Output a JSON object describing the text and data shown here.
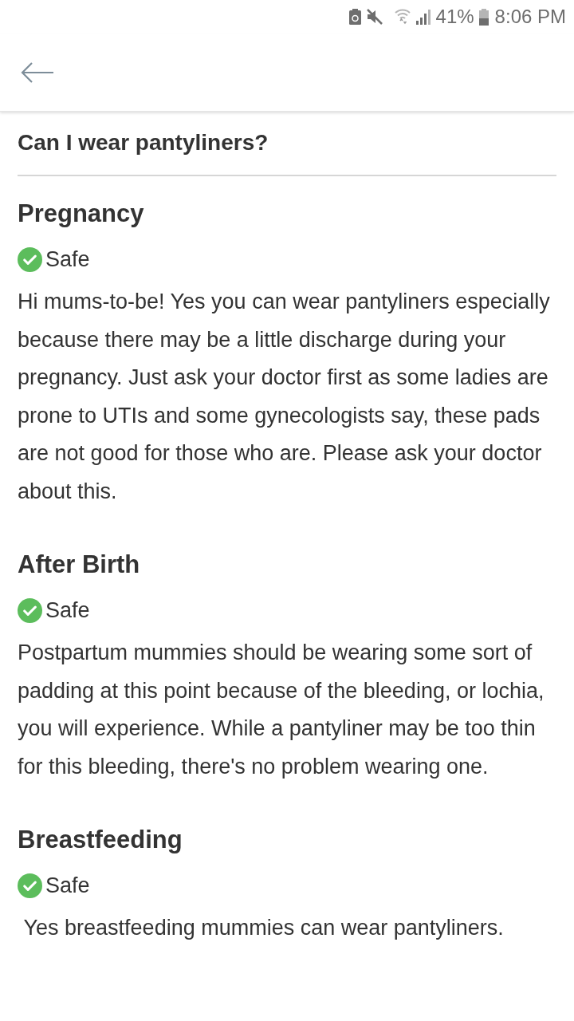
{
  "status_bar": {
    "battery_percent": "41%",
    "time": "8:06 PM"
  },
  "title": "Can I wear pantyliners?",
  "sections": [
    {
      "heading": "Pregnancy",
      "status": {
        "kind": "safe",
        "label": "Safe"
      },
      "text": "Hi mums-to-be! Yes you can wear pantyliners especially because there may be a little discharge during your pregnancy. Just ask your doctor first as some ladies are prone to UTIs and some gynecologists say, these pads are not good for those who are. Please ask your doctor about this."
    },
    {
      "heading": "After Birth",
      "status": {
        "kind": "safe",
        "label": "Safe"
      },
      "text": "Postpartum mummies should be wearing some sort of padding at this point because of the bleeding, or lochia, you will experience. While a pantyliner may be too thin for this bleeding, there's no problem wearing one."
    },
    {
      "heading": "Breastfeeding",
      "status": {
        "kind": "safe",
        "label": "Safe"
      },
      "text": " Yes breastfeeding mummies can wear pantyliners."
    }
  ]
}
